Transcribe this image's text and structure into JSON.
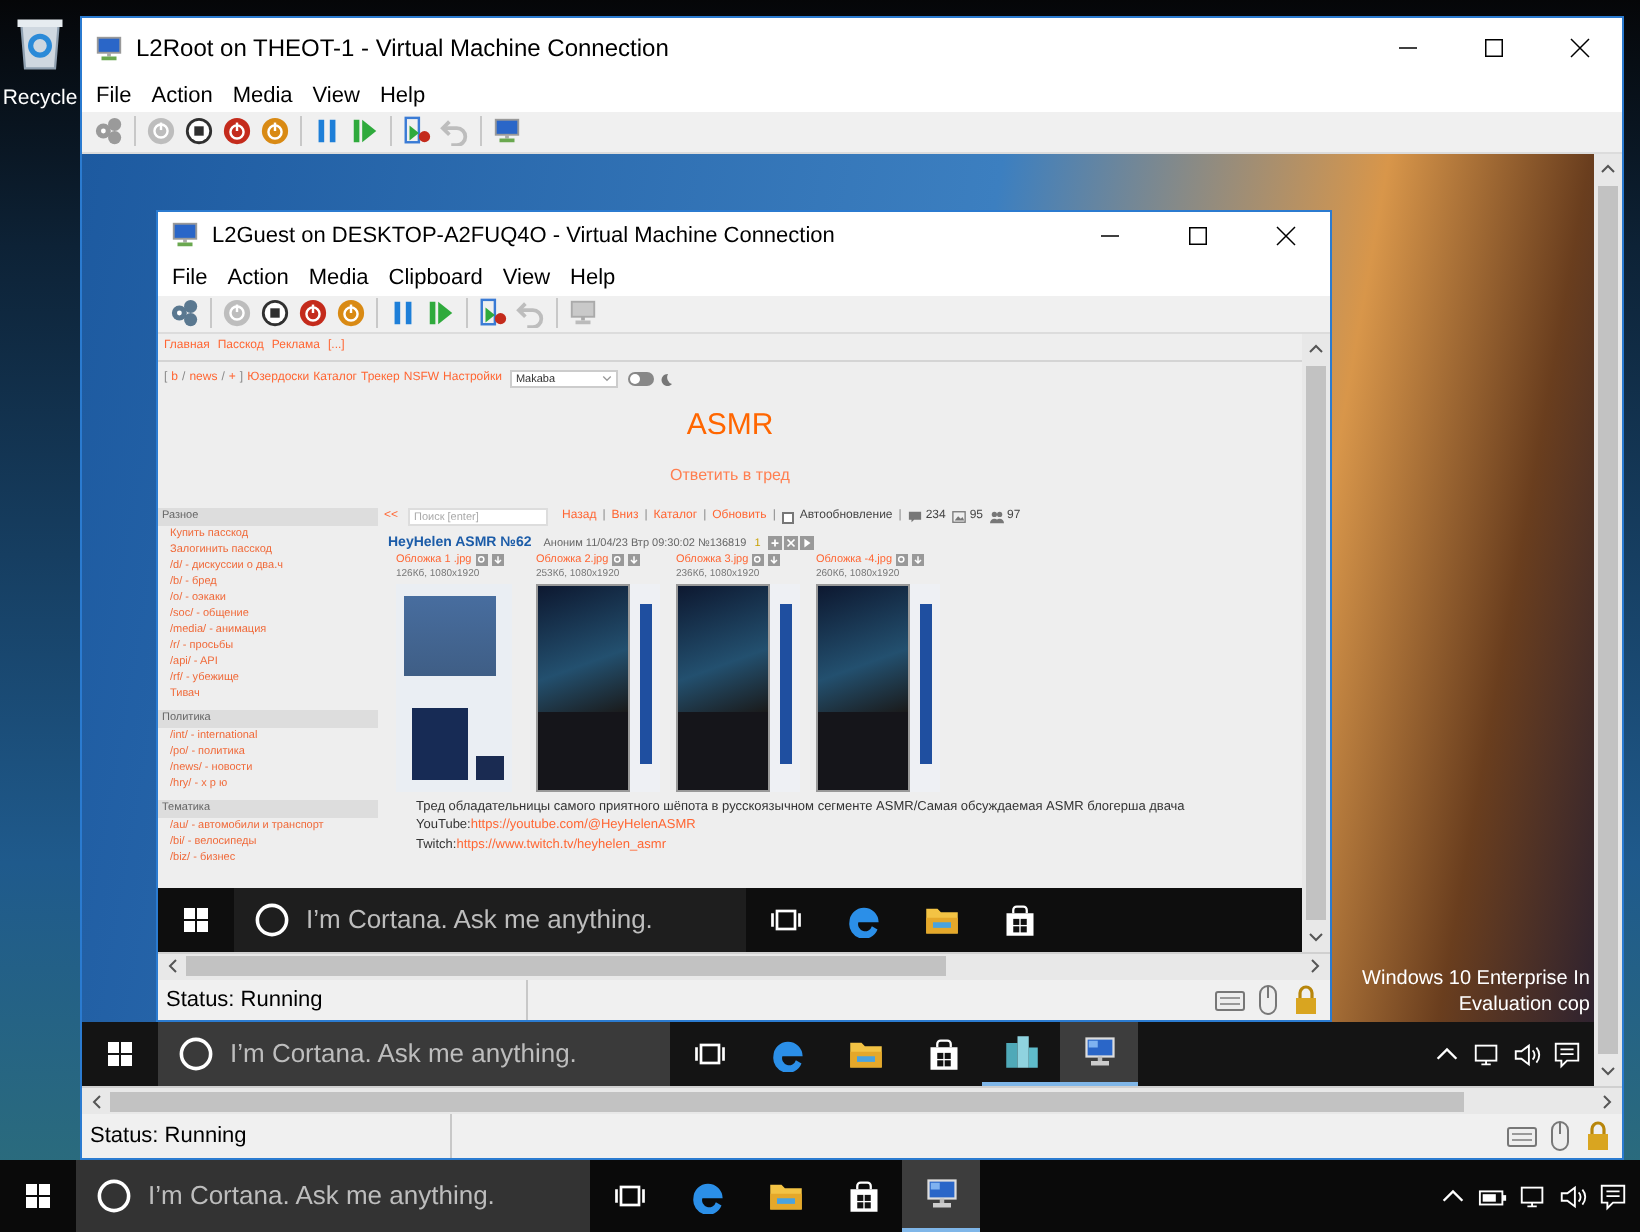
{
  "desktop": {
    "icon_label": "Recycle"
  },
  "host_window": {
    "title": "L2Root on THEOT-1 - Virtual Machine Connection",
    "menu": [
      "File",
      "Action",
      "Media",
      "View",
      "Help"
    ],
    "toolbar": [
      [
        {
          "kind": "ctrl-alt-del",
          "disabled": true
        }
      ],
      [
        {
          "kind": "start",
          "disabled": true
        },
        {
          "kind": "turn-off",
          "disabled": false
        },
        {
          "kind": "shut-down",
          "disabled": false
        },
        {
          "kind": "save",
          "disabled": false
        }
      ],
      [
        {
          "kind": "pause",
          "disabled": false
        },
        {
          "kind": "reset",
          "disabled": false
        }
      ],
      [
        {
          "kind": "checkpoint",
          "disabled": false
        },
        {
          "kind": "revert",
          "disabled": true
        }
      ],
      [
        {
          "kind": "enhanced-session",
          "disabled": false
        }
      ]
    ],
    "screen": {
      "guest_window": {
        "title": "L2Guest on DESKTOP-A2FUQ4O - Virtual Machine Connection",
        "menu": [
          "File",
          "Action",
          "Media",
          "Clipboard",
          "View",
          "Help"
        ],
        "toolbar": [
          [
            {
              "kind": "ctrl-alt-del",
              "disabled": false
            }
          ],
          [
            {
              "kind": "start",
              "disabled": true
            },
            {
              "kind": "turn-off",
              "disabled": false
            },
            {
              "kind": "shut-down",
              "disabled": false
            },
            {
              "kind": "save",
              "disabled": false
            }
          ],
          [
            {
              "kind": "pause",
              "disabled": false
            },
            {
              "kind": "reset",
              "disabled": false
            }
          ],
          [
            {
              "kind": "checkpoint",
              "disabled": false
            },
            {
              "kind": "revert",
              "disabled": true
            }
          ],
          [
            {
              "kind": "enhanced-session",
              "disabled": true
            }
          ]
        ],
        "page": {
          "top_links": [
            "Главная",
            "Пасскод",
            "Реклама",
            "[...]"
          ],
          "board_nav": [
            {
              "kind": "text",
              "text": "["
            },
            {
              "kind": "link",
              "text": "b"
            },
            {
              "kind": "text",
              "text": "/"
            },
            {
              "kind": "link",
              "text": "news"
            },
            {
              "kind": "text",
              "text": "/"
            },
            {
              "kind": "link",
              "text": "+"
            },
            {
              "kind": "text",
              "text": "]"
            },
            {
              "kind": "link",
              "text": "Юзердоски"
            },
            {
              "kind": "link",
              "text": "Каталог"
            },
            {
              "kind": "link",
              "text": "Трекер"
            },
            {
              "kind": "link",
              "text": "NSFW"
            },
            {
              "kind": "link",
              "text": "Настройки"
            }
          ],
          "style_select": "Makaba",
          "dark_mode": false,
          "board_title": "ASMR",
          "reply_link": "Ответить в тред",
          "sidebar": [
            {
              "title": "Разное",
              "items": [
                "Купить пасскод",
                "Залогинить пасскод",
                "/d/ - дискуссии о два.ч",
                "/b/ - бред",
                "/o/ - оэкаки",
                "/soc/ - общение",
                "/media/ - анимация",
                "/r/ - просьбы",
                "/api/ - API",
                "/rf/ - убежище",
                "Тивач"
              ]
            },
            {
              "title": "Политика",
              "items": [
                "/int/ - international",
                "/po/ - политика",
                "/news/ - новости",
                "/hry/ - х р ю"
              ]
            },
            {
              "title": "Тематика",
              "items": [
                "/au/ - автомобили и транспорт",
                "/bi/ - велосипеды",
                "/biz/ - бизнес"
              ]
            }
          ],
          "thread_nav": {
            "back": "<<",
            "search_placeholder": "Поиск [enter]",
            "items": [
              {
                "kind": "link",
                "text": "Назад"
              },
              {
                "kind": "text",
                "text": "|"
              },
              {
                "kind": "link",
                "text": "Вниз"
              },
              {
                "kind": "text",
                "text": "|"
              },
              {
                "kind": "link",
                "text": "Каталог"
              },
              {
                "kind": "text",
                "text": "|"
              },
              {
                "kind": "link",
                "text": "Обновить"
              },
              {
                "kind": "text",
                "text": "|"
              }
            ],
            "autoupdate": {
              "label": "Автообновление",
              "checked": false
            },
            "divider": "|",
            "stats": [
              {
                "kind": "posts",
                "value": "234"
              },
              {
                "kind": "images",
                "value": "95"
              },
              {
                "kind": "users",
                "value": "97"
              }
            ]
          },
          "post": {
            "subject": "HeyHelen ASMR №62",
            "meta": "Аноним 11/04/23 Втр 09:30:02 №136819",
            "counter": "1",
            "files": [
              {
                "kind": "logo",
                "name": "Обложка 1 .jpg",
                "info": "126Кб, 1080x1920"
              },
              {
                "kind": "photo",
                "name": "Обложка 2.jpg",
                "info": "253Кб, 1080x1920"
              },
              {
                "kind": "photo",
                "name": "Обложка 3.jpg",
                "info": "236Кб, 1080x1920"
              },
              {
                "kind": "photo",
                "name": "Обложка -4.jpg",
                "info": "260Кб, 1080x1920"
              }
            ],
            "text": [
              {
                "kind": "plain",
                "text": "Тред обладательницы самого приятного шёпота в русскоязычном сегменте ASMR/Самая обсуждаемая ASMR блогерша двача"
              },
              {
                "kind": "link",
                "label": "YouTube:",
                "url": "https://youtube.com/@HeyHelenASMR"
              },
              {
                "kind": "link",
                "label": "Twitch:",
                "url": "https://www.twitch.tv/heyhelen_asmr"
              }
            ]
          }
        },
        "taskbar": {
          "search_placeholder": "I’m Cortana. Ask me anything.",
          "apps": [
            {
              "kind": "task-view",
              "open": false,
              "selected": false
            },
            {
              "kind": "edge",
              "open": false,
              "selected": false
            },
            {
              "kind": "explorer",
              "open": false,
              "selected": false
            },
            {
              "kind": "store",
              "open": false,
              "selected": false
            }
          ]
        },
        "status": "Status: Running"
      },
      "watermark": [
        "Windows 10 Enterprise In",
        "Evaluation cop"
      ],
      "taskbar": {
        "search_placeholder": "I’m Cortana. Ask me anything.",
        "apps": [
          {
            "kind": "task-view",
            "open": false,
            "selected": false
          },
          {
            "kind": "edge",
            "open": false,
            "selected": false
          },
          {
            "kind": "explorer",
            "open": false,
            "selected": false
          },
          {
            "kind": "store",
            "open": false,
            "selected": false
          },
          {
            "kind": "server-manager",
            "open": true,
            "selected": false
          },
          {
            "kind": "vm-connect",
            "open": true,
            "selected": true
          }
        ],
        "tray": [
          {
            "kind": "chevron"
          },
          {
            "kind": "network"
          },
          {
            "kind": "volume"
          },
          {
            "kind": "notifications"
          }
        ]
      }
    },
    "status": "Status: Running"
  },
  "taskbar": {
    "search_placeholder": "I’m Cortana. Ask me anything.",
    "apps": [
      {
        "kind": "task-view",
        "open": false,
        "selected": false
      },
      {
        "kind": "edge",
        "open": false,
        "selected": false
      },
      {
        "kind": "explorer",
        "open": false,
        "selected": false
      },
      {
        "kind": "store",
        "open": false,
        "selected": false
      },
      {
        "kind": "vm-connect",
        "open": true,
        "selected": true
      }
    ],
    "tray": [
      {
        "kind": "chevron"
      },
      {
        "kind": "battery"
      },
      {
        "kind": "network"
      },
      {
        "kind": "volume"
      },
      {
        "kind": "notifications"
      }
    ]
  }
}
